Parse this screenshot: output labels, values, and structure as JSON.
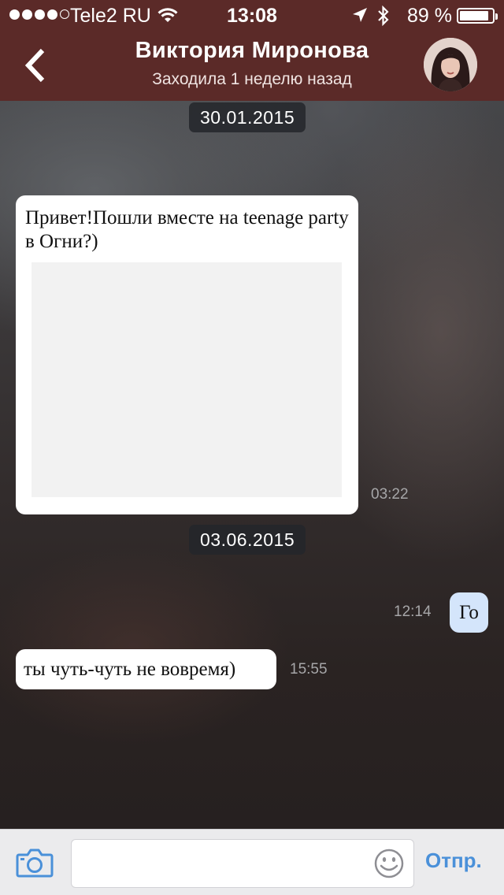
{
  "status_bar": {
    "carrier": "Tele2 RU",
    "time": "13:08",
    "battery_percent_text": "89 %",
    "battery_level": 0.89,
    "signal_dots_filled": 4,
    "signal_dots_total": 5
  },
  "header": {
    "contact_name": "Виктория Миронова",
    "last_seen": "Заходила 1 неделю назад",
    "background_color": "#5b2a28"
  },
  "messages": {
    "date_1": "30.01.2015",
    "msg_1": {
      "text": "Привет!Пошли вместе на teenage party в Огни?)",
      "time": "03:22",
      "has_image": true
    },
    "date_2": "03.06.2015",
    "msg_2": {
      "text": "Го",
      "time": "12:14"
    },
    "msg_3": {
      "text": "ты чуть-чуть не вовремя)",
      "time": "15:55"
    }
  },
  "input_bar": {
    "placeholder": "",
    "send_label": "Отпр.",
    "accent_color": "#4a90d9"
  },
  "icons": {
    "back": "chevron-left-icon",
    "camera": "camera-icon",
    "emoji": "smiley-icon",
    "wifi": "wifi-icon",
    "location": "location-arrow-icon",
    "bluetooth": "bluetooth-icon"
  }
}
